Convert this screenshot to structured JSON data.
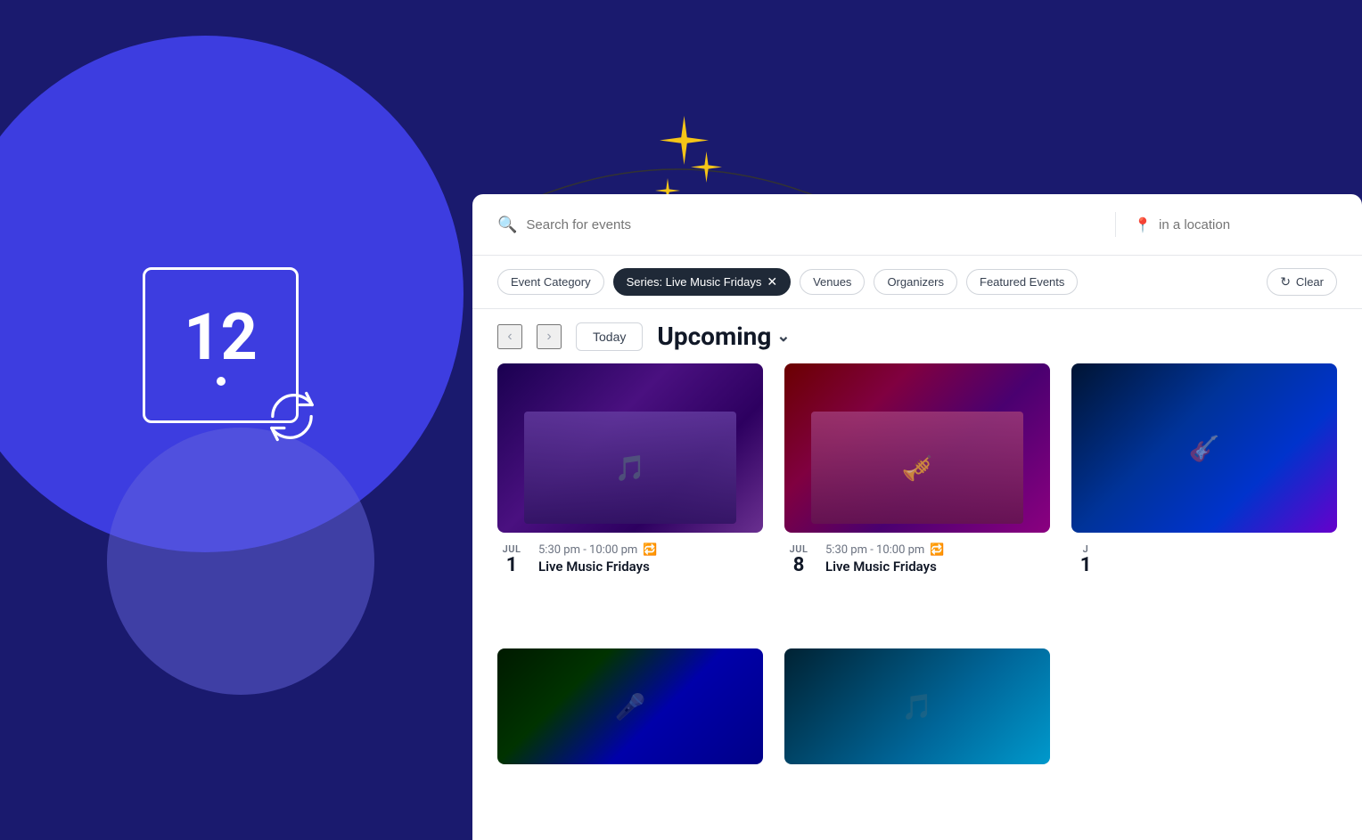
{
  "background": {
    "color": "#1a1a6e"
  },
  "calendar_widget": {
    "number": "12",
    "aria_label": "calendar date"
  },
  "sparkles": {
    "aria_label": "decorative sparkles"
  },
  "search_bar": {
    "search_placeholder": "Search for events",
    "location_placeholder": "in a location",
    "search_icon": "🔍",
    "location_icon": "📍"
  },
  "filters": {
    "chips": [
      {
        "label": "Event Category",
        "active": false,
        "removable": false
      },
      {
        "label": "Series: Live Music Fridays",
        "active": true,
        "removable": true
      },
      {
        "label": "Venues",
        "active": false,
        "removable": false
      },
      {
        "label": "Organizers",
        "active": false,
        "removable": false
      },
      {
        "label": "Featured Events",
        "active": false,
        "removable": false
      }
    ],
    "clear_label": "Clear"
  },
  "navigation": {
    "today_label": "Today",
    "view_label": "Upcoming",
    "prev_icon": "‹",
    "next_icon": "›",
    "chevron_icon": "∨"
  },
  "events": [
    {
      "id": 1,
      "month": "JUL",
      "day": "1",
      "time": "5:30 pm - 10:00 pm",
      "title": "Live Music Fridays",
      "is_recurring": true,
      "image_class": "img-jazz"
    },
    {
      "id": 2,
      "month": "JUL",
      "day": "8",
      "time": "5:30 pm - 10:00 pm",
      "title": "Live Music Fridays",
      "is_recurring": true,
      "image_class": "img-orchestra"
    },
    {
      "id": 3,
      "month": "JUL",
      "day": "1",
      "time": "",
      "title": "",
      "is_recurring": false,
      "image_class": "img-concert",
      "partial": true
    },
    {
      "id": 4,
      "month": "",
      "day": "",
      "time": "",
      "title": "",
      "is_recurring": false,
      "image_class": "img-concert",
      "bottom_row": true
    },
    {
      "id": 5,
      "month": "",
      "day": "",
      "time": "",
      "title": "",
      "is_recurring": false,
      "image_class": "img-singer",
      "bottom_row": true
    }
  ]
}
